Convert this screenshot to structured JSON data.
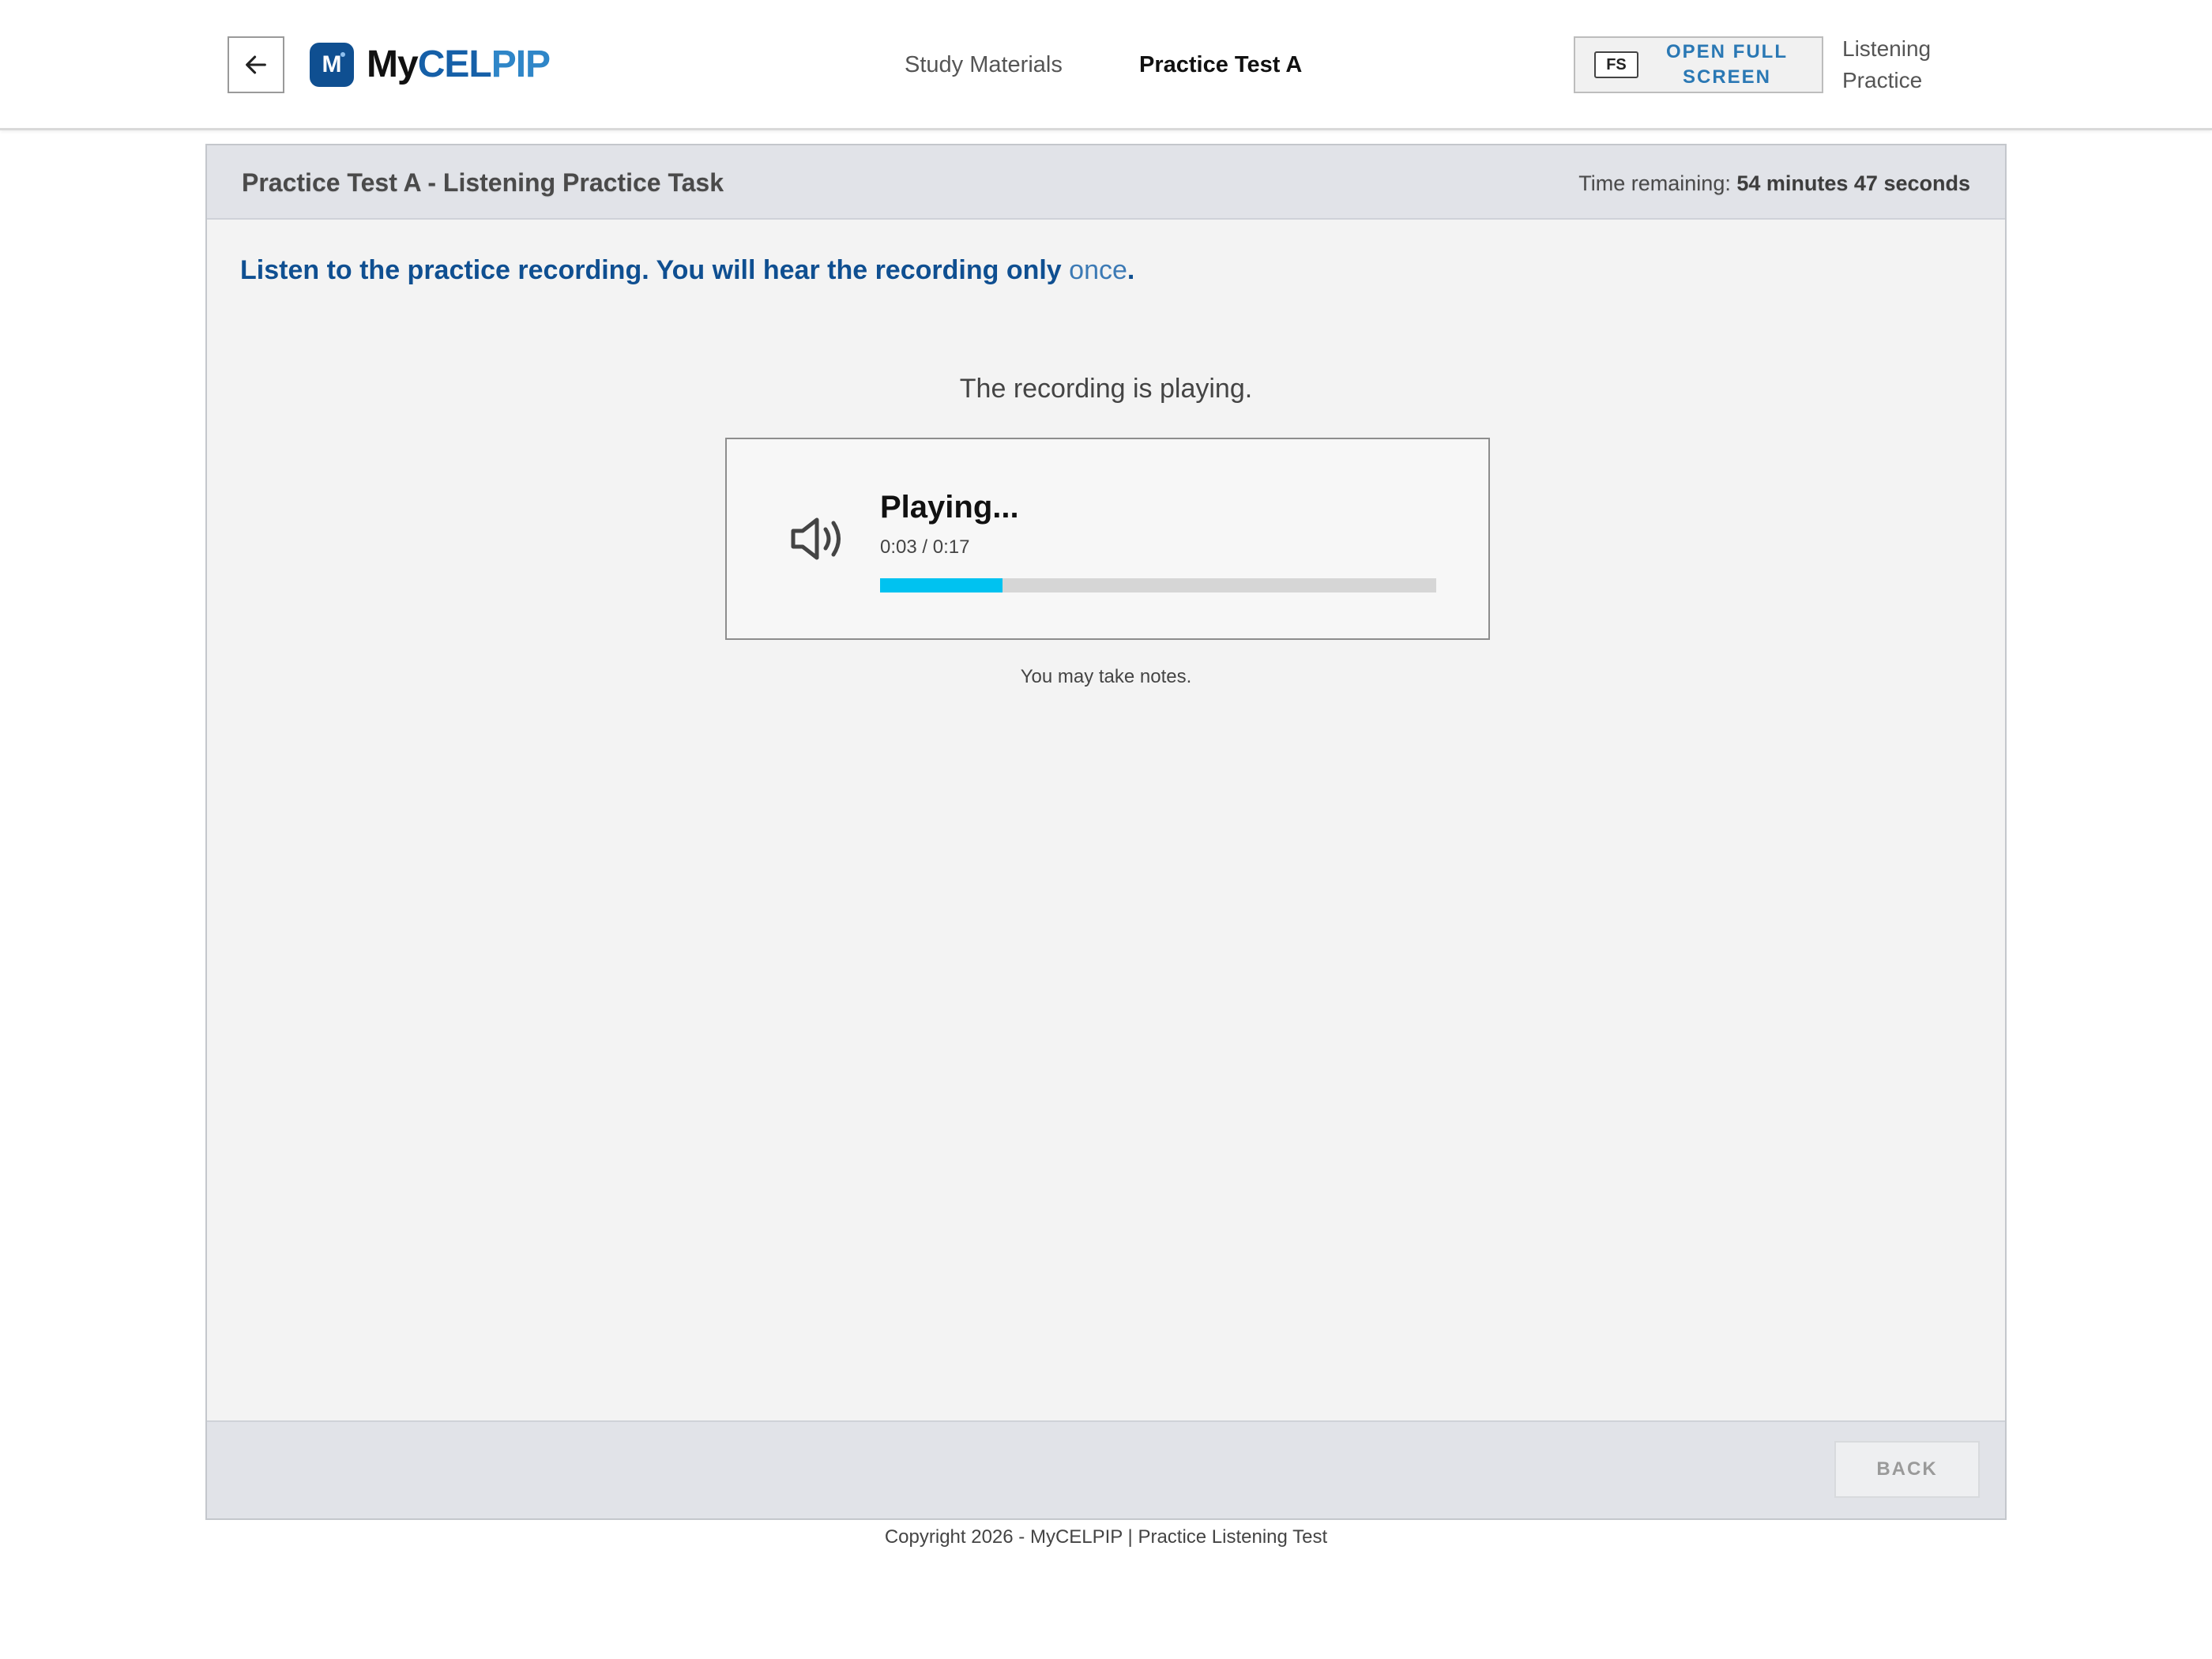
{
  "header": {
    "back_icon": "arrow-left-icon",
    "logo": {
      "badge_letter": "M",
      "part_my": "My",
      "part_cel": "CEL",
      "part_pip": "PIP"
    },
    "nav": {
      "study_materials": "Study Materials",
      "practice_test": "Practice Test A"
    },
    "fullscreen": {
      "key_label": "FS",
      "label": "OPEN FULL SCREEN"
    },
    "section_name": "Listening Practice"
  },
  "panel": {
    "title": "Practice Test A - Listening Practice Task",
    "timer": {
      "prefix": "Time remaining:",
      "value": "54 minutes 47 seconds"
    },
    "instruction": {
      "text": "Listen to the practice recording. You will hear the recording only",
      "highlight": "once",
      "end": "."
    },
    "status": "The recording is playing.",
    "player": {
      "icon": "speaker-icon",
      "title": "Playing...",
      "time": "0:03 / 0:17",
      "progress": 0.22
    },
    "notes_hint": "You may take notes.",
    "footer": {
      "back_label": "BACK"
    }
  },
  "copyright": "Copyright 2026 - MyCELPIP | Practice Listening Test",
  "colors": {
    "brand_dark": "#0f4f91",
    "brand_light": "#2f86c8",
    "progress": "#00c2f0",
    "panel_header": "#e1e3e8"
  }
}
